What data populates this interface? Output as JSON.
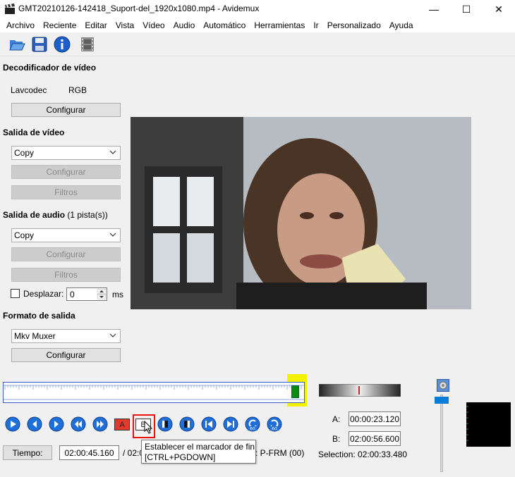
{
  "window": {
    "title": "GMT20210126-142418_Suport-del_1920x1080.mp4 - Avidemux",
    "min": "—",
    "max": "☐",
    "close": "✕"
  },
  "menu": [
    "Archivo",
    "Reciente",
    "Editar",
    "Vista",
    "Vídeo",
    "Audio",
    "Automático",
    "Herramientas",
    "Ir",
    "Personalizado",
    "Ayuda"
  ],
  "video_decoder": {
    "title": "Decodificador de vídeo",
    "codec": "Lavcodec",
    "format": "RGB",
    "configure": "Configurar"
  },
  "video_output": {
    "title": "Salida de vídeo",
    "selected": "Copy",
    "configure": "Configurar",
    "filters": "Filtros"
  },
  "audio_output": {
    "title": "Salida de audio",
    "tracks": "(1 pista(s))",
    "selected": "Copy",
    "configure": "Configurar",
    "filters": "Filtros",
    "shift_label": "Desplazar:",
    "shift_value": "0",
    "shift_unit": "ms"
  },
  "output_format": {
    "title": "Formato de salida",
    "selected": "Mkv Muxer",
    "configure": "Configurar"
  },
  "markers": {
    "a_label": "A:",
    "a_value": "00:00:23.120",
    "b_label": "B:",
    "b_value": "02:00:56.600",
    "selection": "Selection: 02:00:33.480"
  },
  "time": {
    "label": "Tiempo:",
    "current": "02:00:45.160",
    "total_prefix": "/ 02:0",
    "frame_info": ": P-FRM (00)"
  },
  "tooltip": {
    "line1": "Establecer el marcador de fin",
    "line2": "[CTRL+PGDOWN]"
  },
  "nav": {
    "marker_a": "A",
    "marker_b": "B"
  },
  "colors": {
    "accent_blue": "#1e6fd9",
    "highlight": "#f3f300",
    "marker_red": "#e03a2c",
    "cursor_green": "#0b8a10"
  },
  "timeline_position": 0.967
}
